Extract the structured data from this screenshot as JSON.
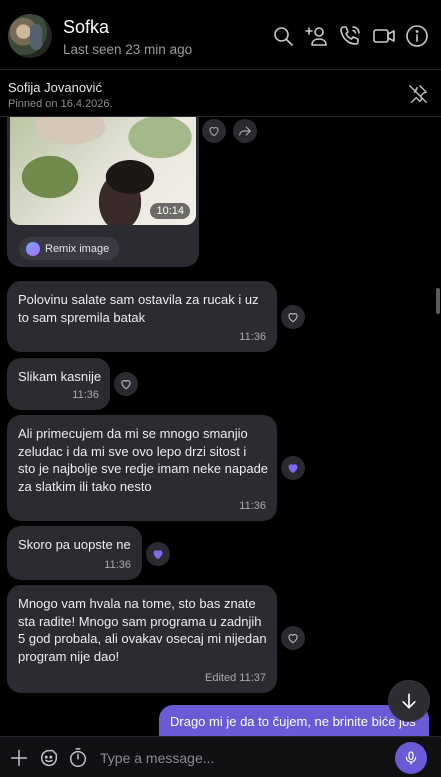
{
  "header": {
    "title": "Sofka",
    "last_seen": "Last seen 23 min ago"
  },
  "pinned": {
    "name": "Sofija Jovanović",
    "date": "Pinned on 16.4.2026."
  },
  "image_message": {
    "time": "10:14",
    "remix_label": "Remix image"
  },
  "messages": [
    {
      "text": "Polovinu salate sam ostavila za rucak i uz\nto sam spremila batak",
      "time": "11:36",
      "reaction": "empty-heart"
    },
    {
      "text": "Slikam kasnije",
      "time": "11:36",
      "reaction": "empty-heart"
    },
    {
      "text": "Ali primecujem da mi se mnogo smanjio\nzeludac i da mi sve ovo lepo drzi sitost i\nsto je najbolje sve redje imam neke napade\nza slatkim ili tako nesto",
      "time": "11:36",
      "reaction": "purple-heart"
    },
    {
      "text": "Skoro pa uopste ne",
      "time": "11:36",
      "reaction": "purple-heart"
    },
    {
      "text": "Mnogo vam hvala na tome, sto bas znate\nsta radite! Mnogo sam programa u zadnjih\n5 god probala, ali ovakav osecaj mi nijedan\nprogram nije dao!",
      "time": "Edited 11:37",
      "reaction": "empty-heart"
    }
  ],
  "outgoing": {
    "text": "Drago mi je da to čujem, ne brinite biće još"
  },
  "composer": {
    "placeholder": "Type a message..."
  },
  "colors": {
    "accent": "#6b5ad6",
    "bubble": "#2b2b31",
    "background": "#000000"
  }
}
